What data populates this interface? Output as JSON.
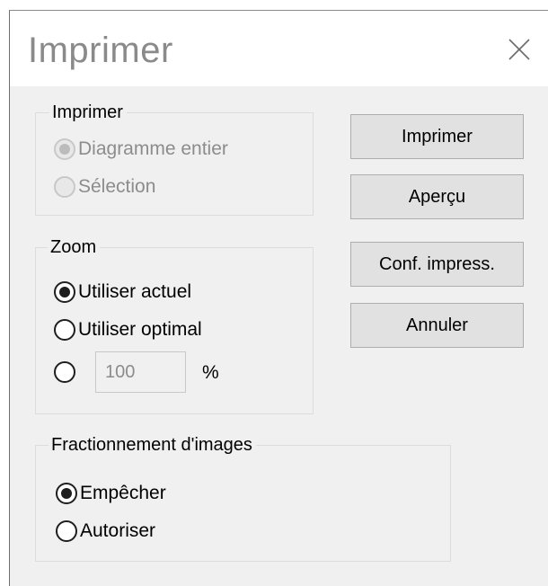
{
  "window": {
    "title": "Imprimer"
  },
  "groups": {
    "print": {
      "legend": "Imprimer",
      "options": [
        {
          "label": "Diagramme entier",
          "checked": true,
          "disabled": true
        },
        {
          "label": "Sélection",
          "checked": false,
          "disabled": true
        }
      ]
    },
    "zoom": {
      "legend": "Zoom",
      "options": [
        {
          "label": "Utiliser actuel",
          "checked": true
        },
        {
          "label": "Utiliser optimal",
          "checked": false
        }
      ],
      "custom": {
        "checked": false,
        "value": "100",
        "unit": "%"
      }
    },
    "split": {
      "legend": "Fractionnement d'images",
      "options": [
        {
          "label": "Empêcher",
          "checked": true
        },
        {
          "label": "Autoriser",
          "checked": false
        }
      ]
    }
  },
  "buttons": {
    "print": "Imprimer",
    "preview": "Aperçu",
    "setup": "Conf. impress.",
    "cancel": "Annuler"
  },
  "icons": {
    "close": "close-icon"
  }
}
